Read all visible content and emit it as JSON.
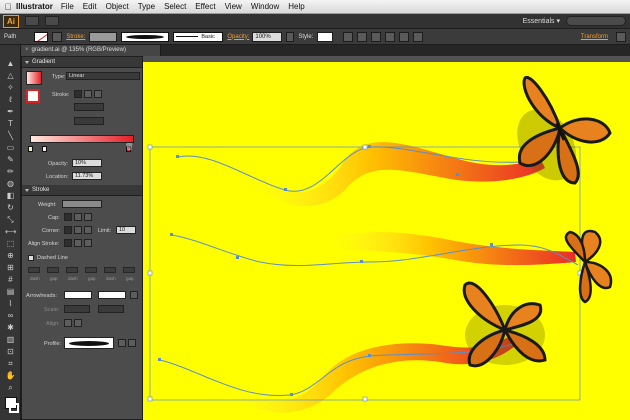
{
  "menubar": {
    "apple": "",
    "app": "Illustrator",
    "items": [
      "File",
      "Edit",
      "Object",
      "Type",
      "Select",
      "Effect",
      "View",
      "Window",
      "Help"
    ]
  },
  "appbar": {
    "logo": "Ai",
    "workspace": "Essentials ▾"
  },
  "controlbar": {
    "selection": "Path",
    "stroke_label": "Stroke:",
    "brush_label": "Basic",
    "opacity_label": "Opacity:",
    "opacity_value": "100%",
    "style_label": "Style:",
    "transform_label": "Transform"
  },
  "document": {
    "tab_title": "gradient.ai @ 135% (RGB/Preview)",
    "close": "×"
  },
  "gradient_panel": {
    "title": "Gradient",
    "type_label": "Type:",
    "type_value": "Linear",
    "stroke_label": "Stroke:",
    "opacity_label": "Opacity:",
    "opacity_value": "10%",
    "location_label": "Location:",
    "location_value": "11.73%",
    "colors": {
      "start": "#ffe9e0",
      "end": "#e5202a"
    }
  },
  "stroke_panel": {
    "title": "Stroke",
    "weight_label": "Weight:",
    "cap_label": "Cap:",
    "corner_label": "Corner:",
    "limit_label": "Limit:",
    "limit_value": "10",
    "align_label": "Align Stroke:",
    "dashed_label": "Dashed Line",
    "dash_labels": [
      "dash",
      "gap",
      "dash",
      "gap",
      "dash",
      "gap"
    ],
    "arrowheads_label": "Arrowheads:",
    "scale_label": "Scale:",
    "align2_label": "Align:",
    "profile_label": "Profile:"
  },
  "colors": {
    "artboard": "#ffff00",
    "ribbon_start": "#ffd400",
    "ribbon_end": "#e8202a",
    "path_guide": "#5b8fc9",
    "butterfly_orange": "#e8821e"
  }
}
